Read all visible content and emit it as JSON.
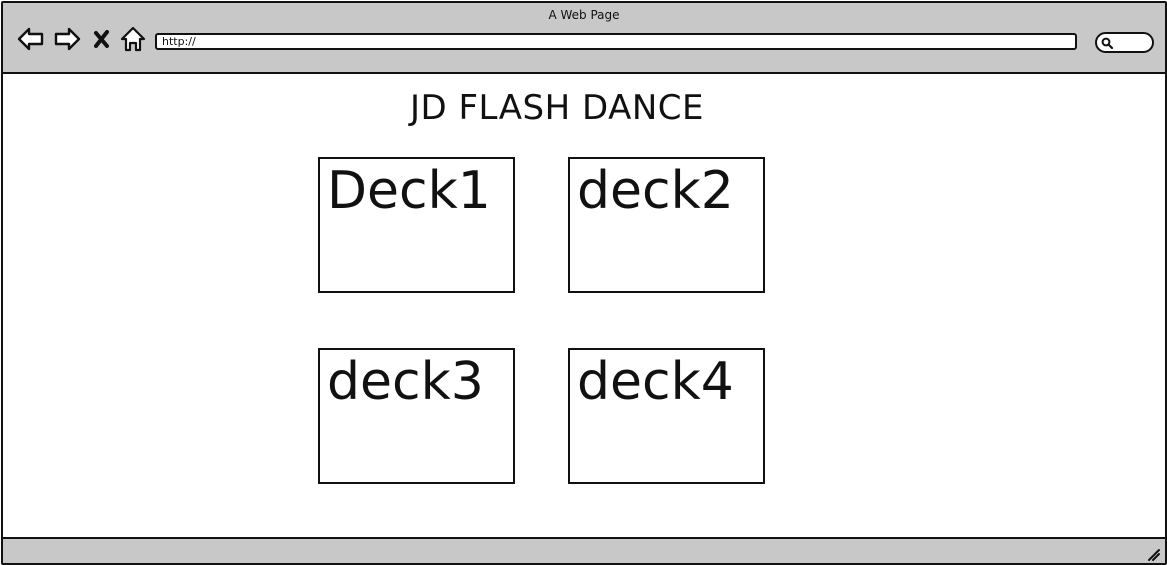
{
  "browser": {
    "window_title": "A Web Page",
    "url": "http://",
    "nav_icons": [
      "back-arrow-icon",
      "forward-arrow-icon",
      "close-x-icon",
      "home-icon"
    ],
    "search_icon": "search-icon"
  },
  "page": {
    "title": "JD FLASH DANCE",
    "decks": [
      {
        "label": "Deck1"
      },
      {
        "label": "deck2"
      },
      {
        "label": "deck3"
      },
      {
        "label": "deck4"
      }
    ]
  },
  "colors": {
    "chrome": "#c8c8c8",
    "ink": "#111111",
    "background": "#ffffff"
  }
}
